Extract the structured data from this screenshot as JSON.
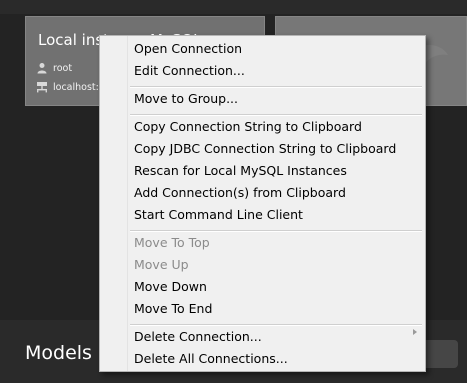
{
  "connections": [
    {
      "title": "Local instance MySQL",
      "user": "root",
      "host": "localhost:3"
    },
    {
      "title": "",
      "user": "",
      "host": ""
    }
  ],
  "models": {
    "title": "Models"
  },
  "context_menu": {
    "groups": [
      {
        "items": [
          {
            "label": "Open Connection",
            "enabled": true
          },
          {
            "label": "Edit Connection...",
            "enabled": true
          }
        ]
      },
      {
        "items": [
          {
            "label": "Move to Group...",
            "enabled": true
          }
        ]
      },
      {
        "items": [
          {
            "label": "Copy Connection String to Clipboard",
            "enabled": true
          },
          {
            "label": "Copy JDBC Connection String to Clipboard",
            "enabled": true
          },
          {
            "label": "Rescan for Local MySQL Instances",
            "enabled": true
          },
          {
            "label": "Add Connection(s) from Clipboard",
            "enabled": true
          },
          {
            "label": "Start Command Line Client",
            "enabled": true
          }
        ]
      },
      {
        "items": [
          {
            "label": "Move To Top",
            "enabled": false
          },
          {
            "label": "Move Up",
            "enabled": false
          },
          {
            "label": "Move Down",
            "enabled": true
          },
          {
            "label": "Move To End",
            "enabled": true
          }
        ]
      },
      {
        "items": [
          {
            "label": "Delete Connection...",
            "enabled": true
          },
          {
            "label": "Delete All Connections...",
            "enabled": true
          }
        ]
      }
    ]
  },
  "colors": {
    "background": "#232323",
    "tile": "#717171",
    "menu_bg": "#f0f0f0",
    "menu_text": "#000000",
    "menu_disabled_text": "#8b8b8b"
  }
}
